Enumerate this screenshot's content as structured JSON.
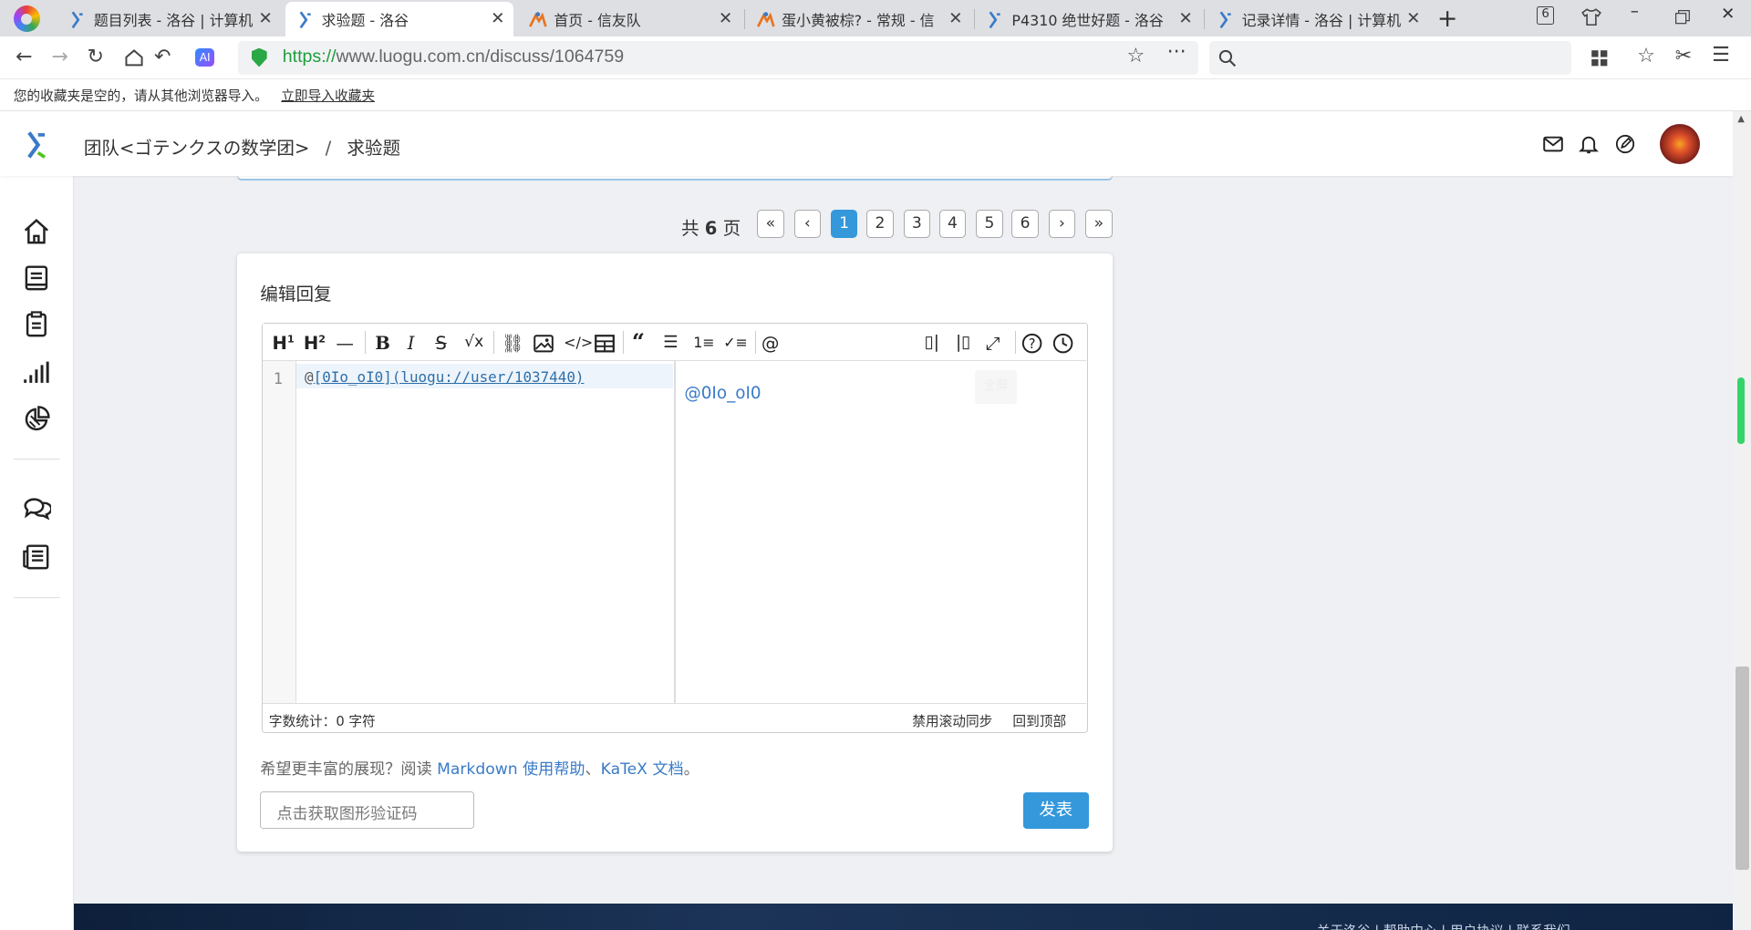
{
  "tabs": [
    {
      "title": "题目列表 - 洛谷 | 计算机",
      "favicon": "luogu-icon",
      "active": false
    },
    {
      "title": "求验题 - 洛谷",
      "favicon": "luogu-icon",
      "active": true
    },
    {
      "title": "首页 - 信友队",
      "favicon": "xinyoudui-icon",
      "active": false
    },
    {
      "title": "蛋小黄被棕? - 常规 - 信",
      "favicon": "xinyoudui-icon",
      "active": false
    },
    {
      "title": "P4310 绝世好题 - 洛谷",
      "favicon": "luogu-icon",
      "active": false
    },
    {
      "title": "记录详情 - 洛谷 | 计算机",
      "favicon": "luogu-icon",
      "active": false
    }
  ],
  "tab_count": "6",
  "address": {
    "scheme": "https://",
    "rest": "www.luogu.com.cn/discuss/1064759"
  },
  "search_placeholder": "",
  "bookmarks": {
    "empty_text": "您的收藏夹是空的，请从其他浏览器导入。",
    "import_link": "立即导入收藏夹"
  },
  "header": {
    "team": "团队<ゴテンクスの数学团>",
    "separator": "/",
    "page": "求验题"
  },
  "pager": {
    "prefix": "共",
    "total": "6",
    "suffix": "页",
    "pages": [
      "1",
      "2",
      "3",
      "4",
      "5",
      "6"
    ],
    "current": "1"
  },
  "editor": {
    "title": "编辑回复",
    "line_number": "1",
    "code_at": "@",
    "code_link_text": "[0Io_oI0]",
    "code_link_url": "(luogu://user/1037440)",
    "preview_text": "@0Io_oI0",
    "fullscreen_hint": "全屏",
    "word_count": "字数统计：0 字符",
    "scroll_sync": "禁用滚动同步",
    "back_to_top": "回到顶部"
  },
  "hint": {
    "prefix": "希望更丰富的展现？阅读 ",
    "markdown": "Markdown 使用帮助",
    "comma": "、",
    "katex": "KaTeX 文档",
    "end": "。"
  },
  "captcha_placeholder": "点击获取图形验证码",
  "submit_label": "发表",
  "footer_text": "关于洛谷 | 帮助中心 | 用户协议 | 联系我们",
  "colors": {
    "accent": "#3498db",
    "luogu_blue": "#3a7bc8",
    "tabbar": "#dedfe3"
  }
}
